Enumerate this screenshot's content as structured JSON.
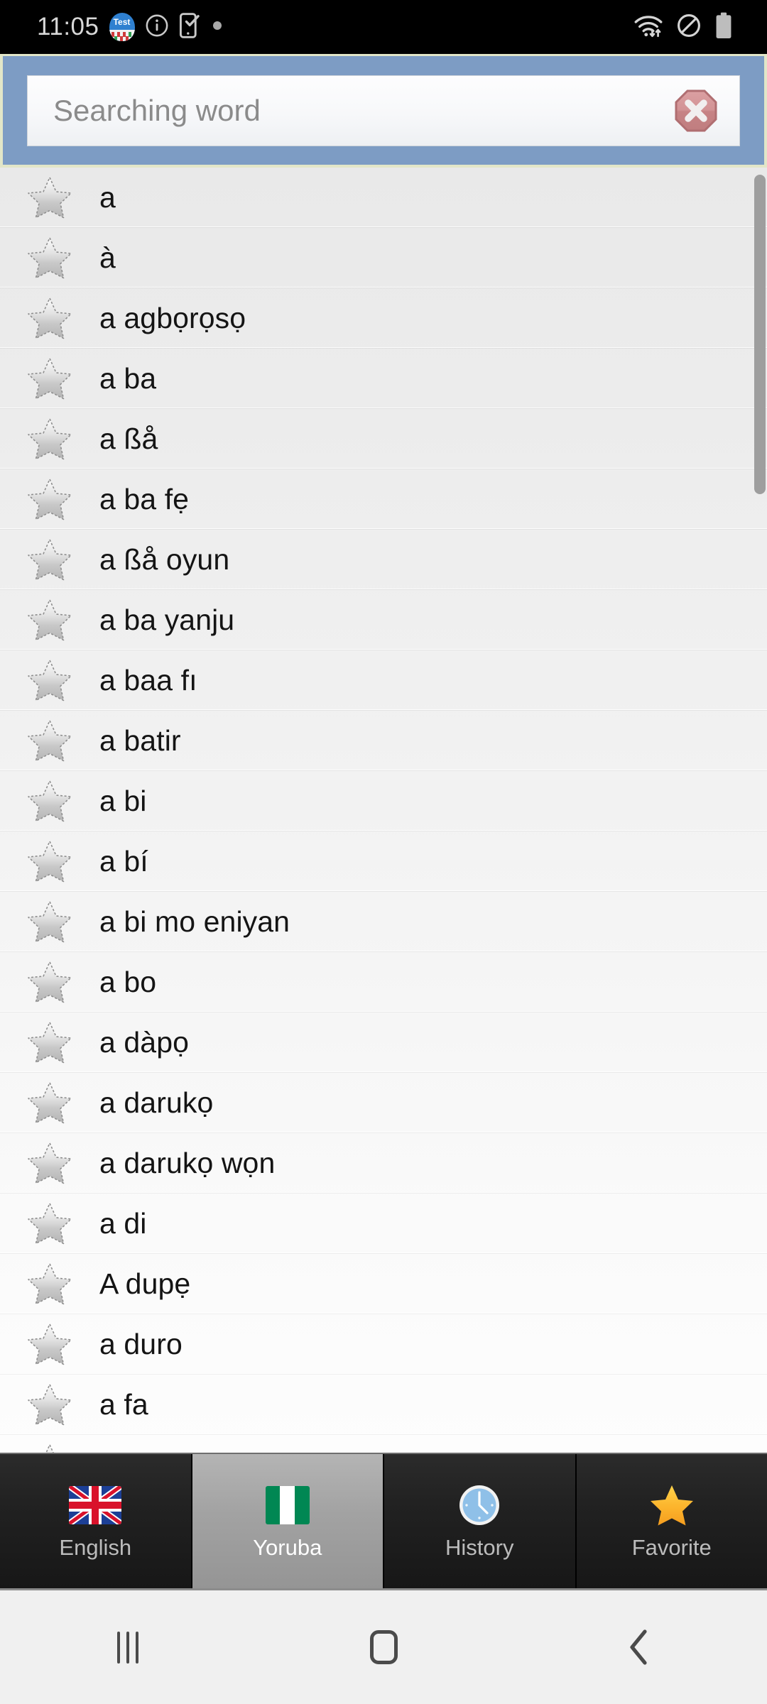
{
  "status_bar": {
    "clock": "11:05",
    "badge_text": "Test",
    "icons_left": [
      "test-app-badge-icon",
      "info-circle-icon",
      "phone-check-icon",
      "dot-icon"
    ],
    "icons_right": [
      "wifi-data-icon",
      "do-not-disturb-icon",
      "battery-full-icon"
    ],
    "background": "#000000",
    "text_color": "#d8d8d8"
  },
  "search": {
    "placeholder": "Searching word",
    "value": "",
    "clear_icon": "clear-octagon-x-icon",
    "header_color": "#7d9cc4",
    "header_border_color": "#e2e6c8",
    "clear_color": "#c97b7e"
  },
  "list": {
    "star_icon": "favorite-star-outline-icon",
    "scrollbar": {
      "visible": true,
      "color": "#9e9e9e"
    },
    "items": [
      {
        "word": "a"
      },
      {
        "word": "à"
      },
      {
        "word": "a agbọrọsọ"
      },
      {
        "word": "a ba"
      },
      {
        "word": "a ßå"
      },
      {
        "word": "a ba fẹ"
      },
      {
        "word": "a ßå oyun"
      },
      {
        "word": "a ba yanju"
      },
      {
        "word": "a baa fı"
      },
      {
        "word": "a batir"
      },
      {
        "word": "a bi"
      },
      {
        "word": "a bí"
      },
      {
        "word": "a bi mo eniyan"
      },
      {
        "word": "a bo"
      },
      {
        "word": "a dàpọ"
      },
      {
        "word": "a darukọ"
      },
      {
        "word": "a darukọ wọn"
      },
      {
        "word": "a di"
      },
      {
        "word": "A dupẹ"
      },
      {
        "word": "a duro"
      },
      {
        "word": "a fa"
      },
      {
        "word": ""
      }
    ]
  },
  "tabs": {
    "selected_index": 1,
    "items": [
      {
        "label": "English",
        "icon": "uk-flag-icon",
        "selected": false
      },
      {
        "label": "Yoruba",
        "icon": "nigeria-flag-icon",
        "selected": true
      },
      {
        "label": "History",
        "icon": "clock-icon",
        "selected": false
      },
      {
        "label": "Favorite",
        "icon": "star-filled-icon",
        "selected": false
      }
    ]
  },
  "android_nav": {
    "recents_label": "recents-button",
    "home_label": "home-button",
    "back_label": "back-button"
  }
}
